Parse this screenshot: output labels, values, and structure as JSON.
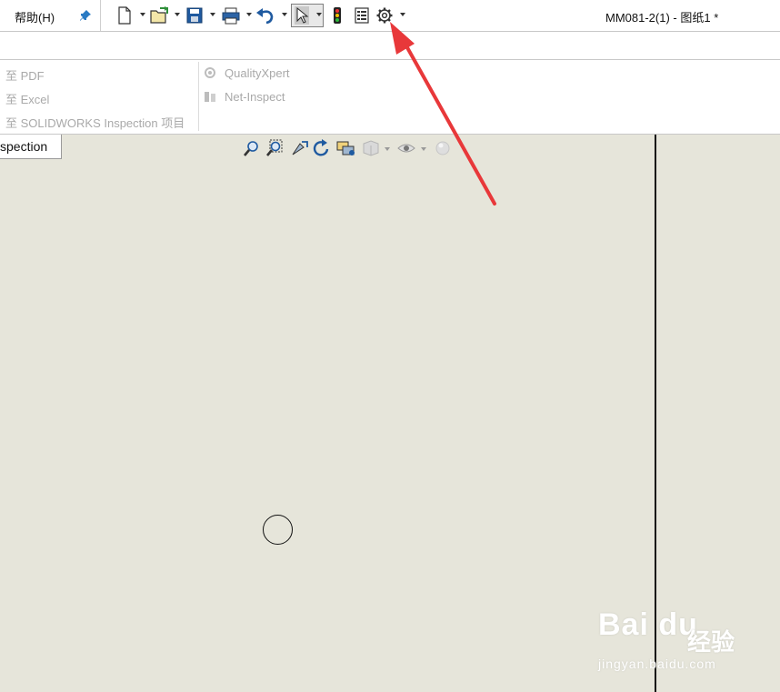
{
  "menu": {
    "help_label": "帮助(H)"
  },
  "window": {
    "title": "MM081-2(1) - 图纸1 *"
  },
  "ribbon": {
    "left_items": [
      "至 PDF",
      "至 Excel",
      "至 SOLIDWORKS Inspection 项目"
    ],
    "right_items": [
      "QualityXpert",
      "Net-Inspect"
    ]
  },
  "tab": {
    "label": "spection"
  },
  "watermark": {
    "brand": "Bai du",
    "cn": "经验",
    "url": "jingyan.baidu.com"
  },
  "icons": [
    "pin-icon",
    "new-file-icon",
    "open-file-icon",
    "save-icon",
    "print-icon",
    "undo-icon",
    "select-pointer-icon",
    "traffic-light-icon",
    "file-properties-icon",
    "gear-icon",
    "zoom-to-fit-icon",
    "zoom-area-icon",
    "previous-view-icon",
    "rotate-icon",
    "pan-icon",
    "view-orientation-icon",
    "hide-show-icon",
    "appearance-icon"
  ],
  "colors": {
    "canvas": "#e6e5da",
    "arrow": "#e8383a",
    "accent": "#1f6fb2"
  }
}
